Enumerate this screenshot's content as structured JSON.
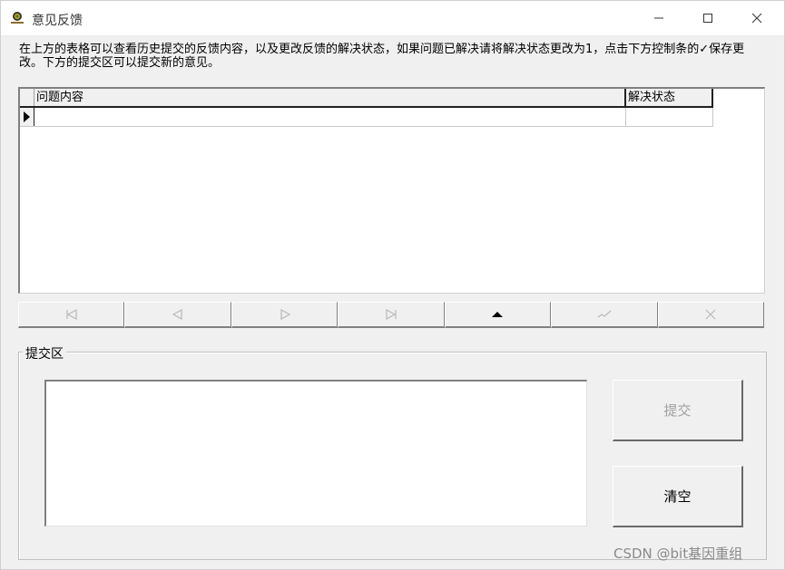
{
  "window": {
    "title": "意见反馈",
    "icon": "app-logo-icon"
  },
  "instruction": "在上方的表格可以查看历史提交的反馈内容，以及更改反馈的解决状态，如果问题已解决请将解决状态更改为1，点击下方控制条的✓保存更改。下方的提交区可以提交新的意见。",
  "grid": {
    "columns": [
      "问题内容",
      "解决状态"
    ],
    "rows": [
      {
        "content": "",
        "status": ""
      }
    ]
  },
  "navigator": {
    "buttons": [
      {
        "name": "first-record",
        "icon": "first-icon",
        "enabled": false
      },
      {
        "name": "prior-record",
        "icon": "prior-icon",
        "enabled": false
      },
      {
        "name": "next-record",
        "icon": "next-icon",
        "enabled": false
      },
      {
        "name": "last-record",
        "icon": "last-icon",
        "enabled": false
      },
      {
        "name": "edit-record",
        "icon": "triangle-up-icon",
        "enabled": true
      },
      {
        "name": "post-record",
        "icon": "checkmark-icon",
        "enabled": false
      },
      {
        "name": "cancel-record",
        "icon": "cancel-x-icon",
        "enabled": false
      }
    ]
  },
  "submit_group": {
    "label": "提交区",
    "text_value": "",
    "submit_label": "提交",
    "clear_label": "清空"
  },
  "watermark": "CSDN @bit基因重组",
  "colors": {
    "window_bg": "#f0f0f0",
    "disabled_text": "#a0a0a0"
  }
}
